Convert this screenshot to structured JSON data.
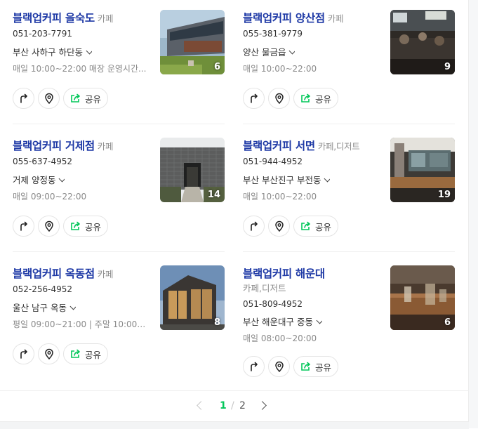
{
  "places": [
    {
      "name": "블랙업커피 을숙도",
      "category": "카페",
      "phone": "051-203-7791",
      "address": "부산 사하구 하단동",
      "hours": "매일 10:00~22:00 매장 운영시간...",
      "photo_count": "6",
      "share_label": "공유"
    },
    {
      "name": "블랙업커피 양산점",
      "category": "카페",
      "phone": "055-381-9779",
      "address": "양산 물금읍",
      "hours": "매일 10:00~22:00",
      "photo_count": "9",
      "share_label": "공유"
    },
    {
      "name": "블랙업커피 거제점",
      "category": "카페",
      "phone": "055-637-4952",
      "address": "거제 양정동",
      "hours": "매일 09:00~22:00",
      "photo_count": "14",
      "share_label": "공유"
    },
    {
      "name": "블랙업커피 서면",
      "category": "카페,디저트",
      "phone": "051-944-4952",
      "address": "부산 부산진구 부전동",
      "hours": "매일 10:00~22:00",
      "photo_count": "19",
      "share_label": "공유"
    },
    {
      "name": "블랙업커피 옥동점",
      "category": "카페",
      "phone": "052-256-4952",
      "address": "울산 남구 옥동",
      "hours": "평일 09:00~21:00 | 주말 10:00~...",
      "photo_count": "8",
      "share_label": "공유"
    },
    {
      "name": "블랙업커피 해운대",
      "category": "카페,디저트",
      "phone": "051-809-4952",
      "address": "부산 해운대구 중동",
      "hours": "매일 08:00~20:00",
      "photo_count": "6",
      "share_label": "공유"
    }
  ],
  "pagination": {
    "current": "1",
    "separator": "/",
    "total": "2"
  },
  "colors": {
    "title": "#1f3aa6",
    "accent": "#03c75a",
    "muted": "#8f8f8f"
  },
  "icons": [
    "directions-icon",
    "map-pin-icon",
    "share-icon",
    "chevron-down-icon",
    "chevron-left-icon",
    "chevron-right-icon"
  ]
}
